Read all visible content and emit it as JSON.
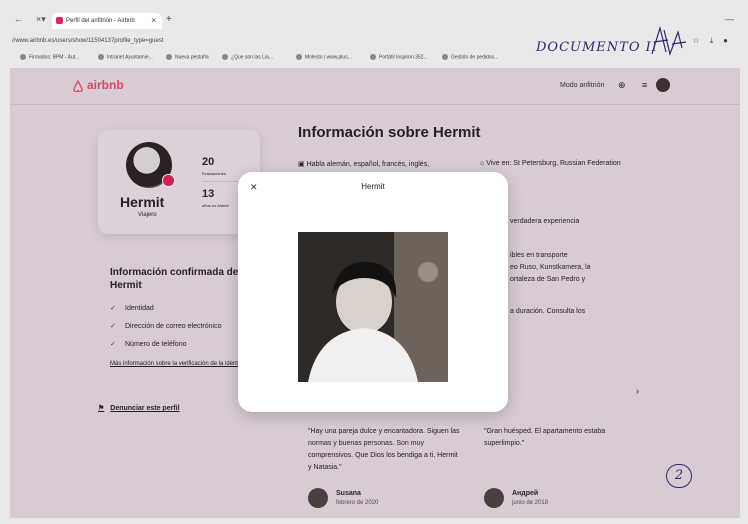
{
  "browser": {
    "tab_title": "Perfil del anfitrión - Airbnb",
    "url": "//www.airbnb.es/users/show/11504137profile_type=guest",
    "bookmarks": [
      "Firmados: BPM - Aut...",
      "Intranet Ayuntamie...",
      "Nueva pestaña",
      "¿Que son las Lia...",
      "Molesto | www.plus...",
      "Portátil Inspiron 352...",
      "Gestión de pedidos..."
    ]
  },
  "annotation": {
    "handwritten": "DOCUMENTO II",
    "page_number": "2"
  },
  "header": {
    "brand": "airbnb",
    "host_mode": "Modo anfitrión"
  },
  "profile": {
    "name": "Hermit",
    "role": "Viajero",
    "reviews_count": "20",
    "reviews_label": "Evaluaciones",
    "years_count": "13",
    "years_label": "años en Airbnb"
  },
  "confirmed": {
    "title": "Información confirmada de Hermit",
    "items": [
      "Identidad",
      "Dirección de correo electrónico",
      "Número de teléfono"
    ],
    "link": "Más información sobre la verificación de la identidad",
    "report": "Denunciar este perfil"
  },
  "about": {
    "title": "Información sobre Hermit",
    "languages": "Habla alemán, español, francés, inglés,",
    "lives": "Vive en: St Petersburg, Russian Federation",
    "fragments": [
      "verdadera experiencia",
      "ibles en transporte",
      "eo Ruso, Kunstkamera, la",
      "ortaleza de San Pedro y",
      "a duración. Consulta los"
    ]
  },
  "reviews": [
    {
      "text": "\"Hay una pareja dulce y encantadora. Siguen las normas y buenas personas. Son muy comprensivos. Que Dios los bendiga a ti, Hermit y Natasia.\"",
      "name": "Susana",
      "date": "febrero de 2020"
    },
    {
      "text": "\"Gran huésped. El apartamento estaba superlimpio.\"",
      "name": "Андрей",
      "date": "junio de 2018"
    }
  ],
  "modal": {
    "title": "Hermit"
  }
}
